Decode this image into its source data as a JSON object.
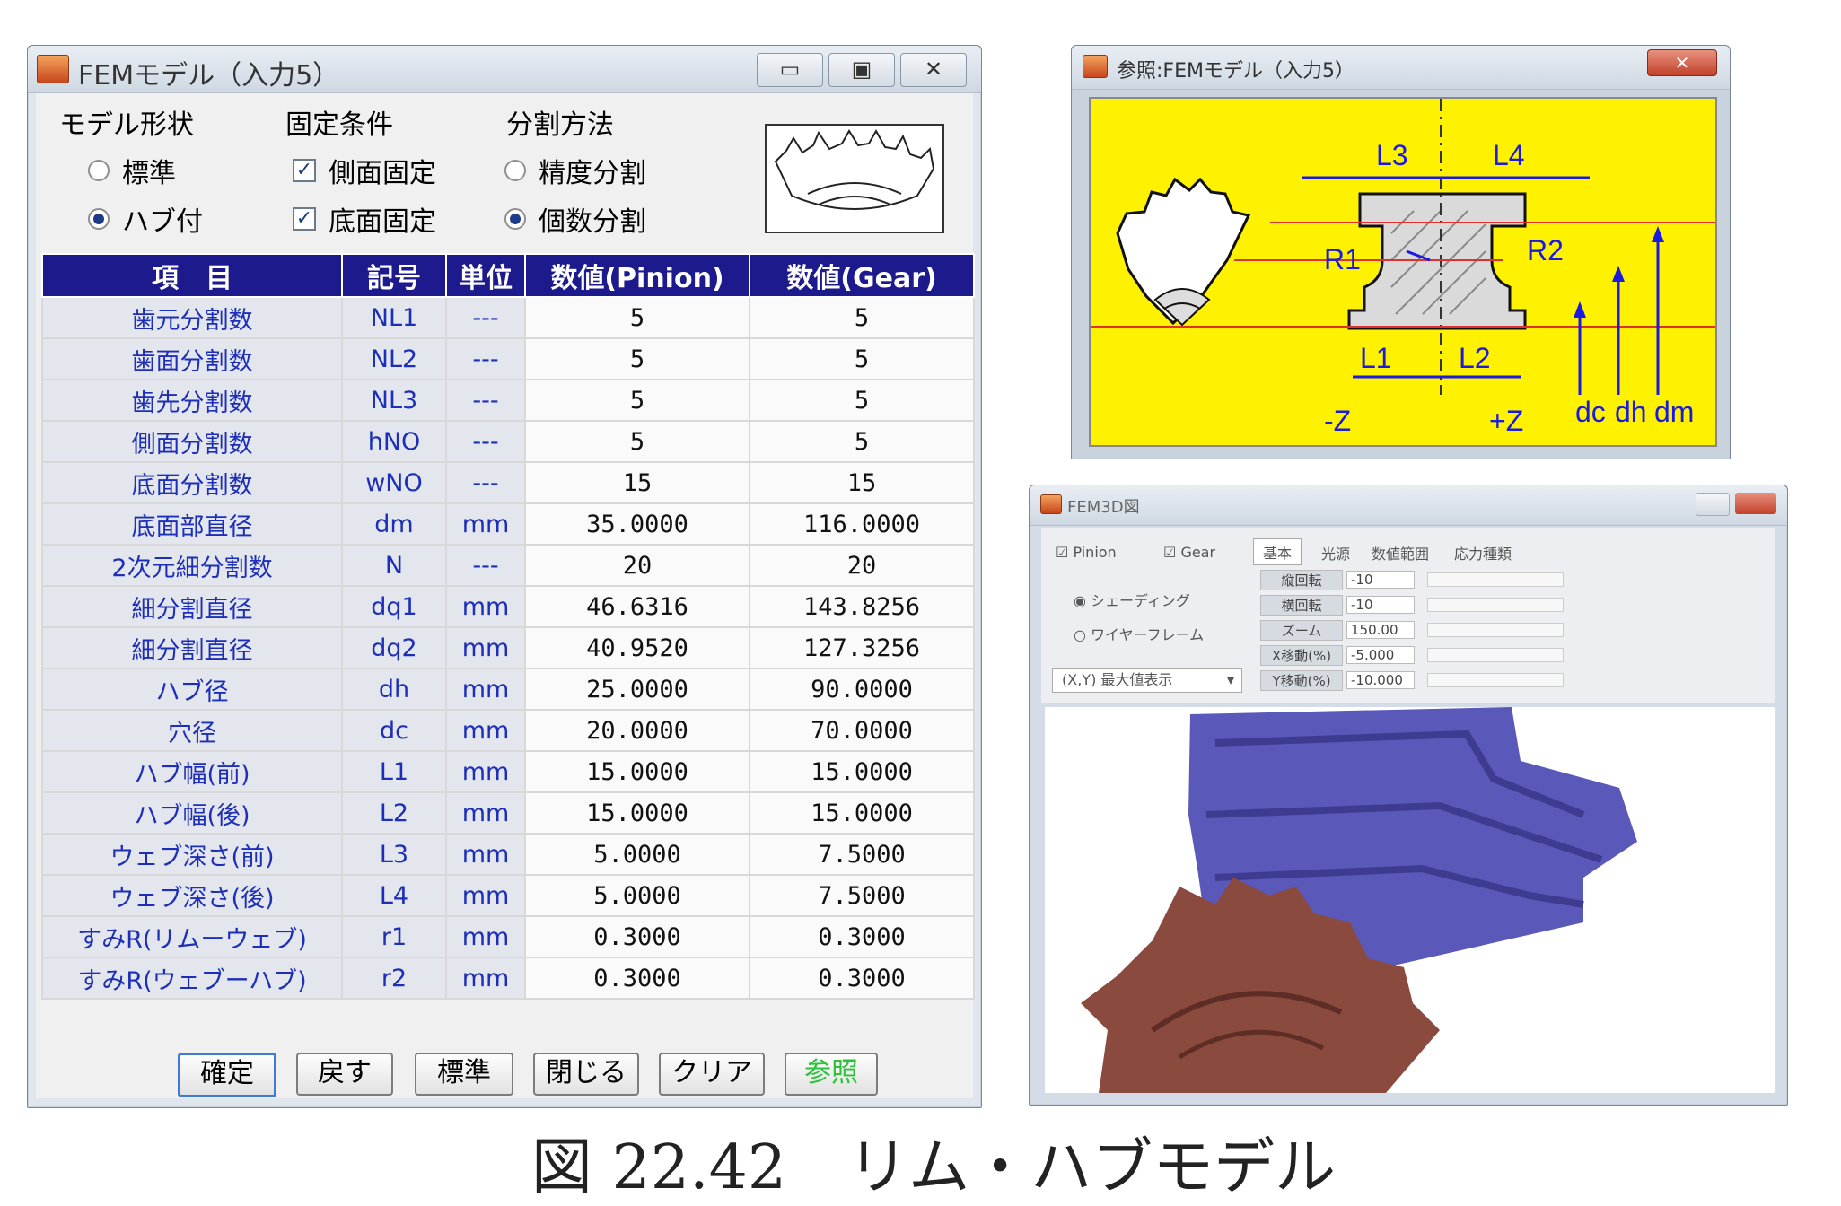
{
  "fem_window": {
    "title": "FEMモデル（入力5）",
    "controls": {
      "minimize": "▭",
      "maximize": "▣",
      "close": "✕"
    },
    "model_shape": {
      "label": "モデル形状",
      "options": [
        "標準",
        "ハブ付"
      ],
      "selected": "ハブ付"
    },
    "fixed_condition": {
      "label": "固定条件",
      "options": [
        "側面固定",
        "底面固定"
      ],
      "checked": [
        true,
        true
      ]
    },
    "division_method": {
      "label": "分割方法",
      "options": [
        "精度分割",
        "個数分割"
      ],
      "selected": "個数分割"
    },
    "table": {
      "headers": [
        "項　目",
        "記号",
        "単位",
        "数値(Pinion)",
        "数値(Gear)"
      ],
      "rows": [
        {
          "name": "歯元分割数",
          "symbol": "NL1",
          "unit": "---",
          "pinion": "5",
          "gear": "5"
        },
        {
          "name": "歯面分割数",
          "symbol": "NL2",
          "unit": "---",
          "pinion": "5",
          "gear": "5"
        },
        {
          "name": "歯先分割数",
          "symbol": "NL3",
          "unit": "---",
          "pinion": "5",
          "gear": "5"
        },
        {
          "name": "側面分割数",
          "symbol": "hNO",
          "unit": "---",
          "pinion": "5",
          "gear": "5"
        },
        {
          "name": "底面分割数",
          "symbol": "wNO",
          "unit": "---",
          "pinion": "15",
          "gear": "15"
        },
        {
          "name": "底面部直径",
          "symbol": "dm",
          "unit": "mm",
          "pinion": "35.0000",
          "gear": "116.0000"
        },
        {
          "name": "2次元細分割数",
          "symbol": "N",
          "unit": "---",
          "pinion": "20",
          "gear": "20"
        },
        {
          "name": "細分割直径",
          "symbol": "dq1",
          "unit": "mm",
          "pinion": "46.6316",
          "gear": "143.8256"
        },
        {
          "name": "細分割直径",
          "symbol": "dq2",
          "unit": "mm",
          "pinion": "40.9520",
          "gear": "127.3256"
        },
        {
          "name": "ハブ径",
          "symbol": "dh",
          "unit": "mm",
          "pinion": "25.0000",
          "gear": "90.0000"
        },
        {
          "name": "穴径",
          "symbol": "dc",
          "unit": "mm",
          "pinion": "20.0000",
          "gear": "70.0000"
        },
        {
          "name": "ハブ幅(前)",
          "symbol": "L1",
          "unit": "mm",
          "pinion": "15.0000",
          "gear": "15.0000"
        },
        {
          "name": "ハブ幅(後)",
          "symbol": "L2",
          "unit": "mm",
          "pinion": "15.0000",
          "gear": "15.0000"
        },
        {
          "name": "ウェブ深さ(前)",
          "symbol": "L3",
          "unit": "mm",
          "pinion": "5.0000",
          "gear": "7.5000"
        },
        {
          "name": "ウェブ深さ(後)",
          "symbol": "L4",
          "unit": "mm",
          "pinion": "5.0000",
          "gear": "7.5000"
        },
        {
          "name": "すみR(リムーウェブ)",
          "symbol": "r1",
          "unit": "mm",
          "pinion": "0.3000",
          "gear": "0.3000"
        },
        {
          "name": "すみR(ウェブーハブ)",
          "symbol": "r2",
          "unit": "mm",
          "pinion": "0.3000",
          "gear": "0.3000"
        }
      ]
    },
    "buttons": [
      "確定",
      "戻す",
      "標準",
      "閉じる",
      "クリア",
      "参照"
    ]
  },
  "reference_window": {
    "title": "参照:FEMモデル（入力5）",
    "close": "✕",
    "labels": {
      "l1": "L1",
      "l2": "L2",
      "l3": "L3",
      "l4": "L4",
      "r1": "R1",
      "r2": "R2",
      "dc": "dc",
      "dh": "dh",
      "dm": "dm",
      "minus_z": "-Z",
      "plus_z": "+Z"
    }
  },
  "fem3d_window": {
    "title": "FEM3D図",
    "checks": {
      "pinion": "Pinion",
      "gear": "Gear"
    },
    "render_modes": [
      "シェーディング",
      "ワイヤーフレーム"
    ],
    "render_selected": "シェーディング",
    "view_select": "(X,Y) 最大値表示",
    "tabs": [
      "基本",
      "光源",
      "数値範囲",
      "応力種類"
    ],
    "params": [
      {
        "label": "縦回転",
        "value": "-10"
      },
      {
        "label": "横回転",
        "value": "-10"
      },
      {
        "label": "ズーム",
        "value": "150.00"
      },
      {
        "label": "X移動(%)",
        "value": "-5.000"
      },
      {
        "label": "Y移動(%)",
        "value": "-10.000"
      }
    ],
    "colors": {
      "gear": "#5a58b8",
      "pinion": "#8a4a3e"
    }
  },
  "caption": "図 22.42　リム・ハブモデル",
  "colors": {
    "header_bg": "#1c1a8c",
    "label_text": "#1d2fb8",
    "reference_bg": "#fff200",
    "accent_green": "#2cc23a"
  }
}
